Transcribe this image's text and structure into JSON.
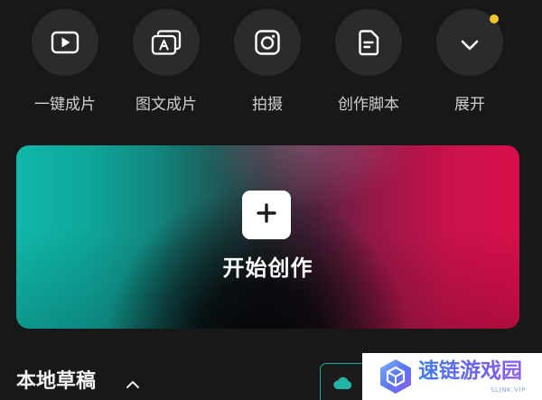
{
  "screen": {
    "theme": "dark",
    "background": "#181818"
  },
  "quick_actions": [
    {
      "label": "一键成片",
      "icon": "play-icon"
    },
    {
      "label": "图文成片",
      "icon": "image-text-icon"
    },
    {
      "label": "拍摄",
      "icon": "camera-icon"
    },
    {
      "label": "创作脚本",
      "icon": "script-icon"
    },
    {
      "label": "展开",
      "icon": "chevron-down-icon",
      "notification_dot": true
    }
  ],
  "create_card": {
    "label": "开始创作",
    "icon": "plus-icon",
    "gradient_colors": [
      "#10b8aa",
      "#111114",
      "#d80f4b"
    ]
  },
  "drafts": {
    "title": "本地草稿",
    "toggle_icon": "chevron-up-icon",
    "cloud_button_icon": "cloud-icon"
  },
  "watermark": {
    "brand_name": "速链游戏园",
    "domain": "SLINK.VIP",
    "logo_icon": "gem-logo-icon"
  },
  "colors": {
    "circle": "#2b2b2b",
    "label": "#cfcfcf",
    "notification_dot": "#f2c230",
    "accent_teal": "#1aa898",
    "watermark_text": "#5b66e8"
  }
}
